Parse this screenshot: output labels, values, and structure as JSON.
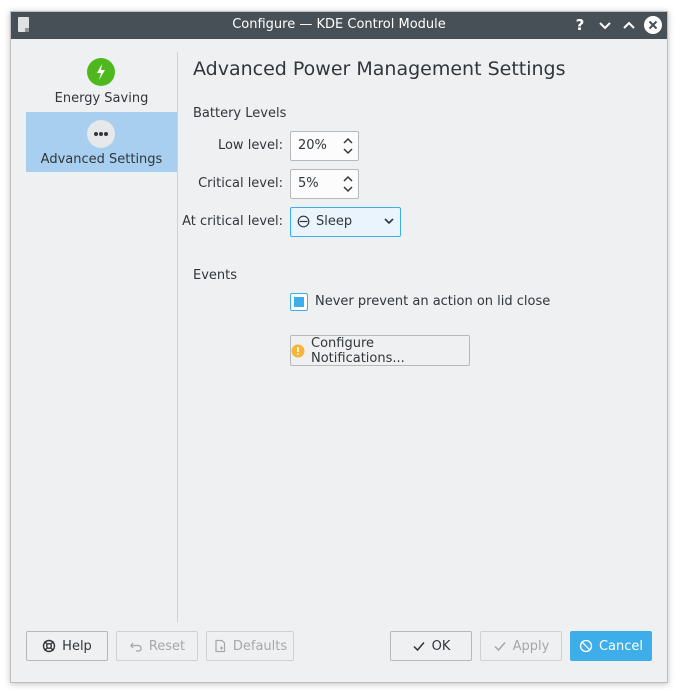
{
  "window": {
    "title": "Configure — KDE Control Module",
    "controls": [
      "help-icon",
      "minimize-icon",
      "maximize-icon",
      "close-icon"
    ]
  },
  "sidebar": {
    "items": [
      {
        "label": "Energy Saving",
        "icon": "energy-saving-icon",
        "selected": false
      },
      {
        "label": "Advanced Settings",
        "icon": "advanced-settings-icon",
        "selected": true
      }
    ]
  },
  "main": {
    "title": "Advanced Power Management Settings",
    "battery": {
      "heading": "Battery Levels",
      "low_label": "Low level:",
      "low_value": "20%",
      "critical_label": "Critical level:",
      "critical_value": "5%",
      "action_label": "At critical level:",
      "action_value": "Sleep"
    },
    "events": {
      "heading": "Events",
      "lid_label": "Never prevent an action on lid close",
      "lid_checked": true,
      "notifications_label": "Configure Notifications..."
    }
  },
  "footer": {
    "help": "Help",
    "reset": "Reset",
    "defaults": "Defaults",
    "ok": "OK",
    "apply": "Apply",
    "cancel": "Cancel"
  },
  "colors": {
    "titlebar": "#475057",
    "accent": "#3daee9",
    "selection": "#a8cfef",
    "energy_icon": "#4eb81e"
  }
}
